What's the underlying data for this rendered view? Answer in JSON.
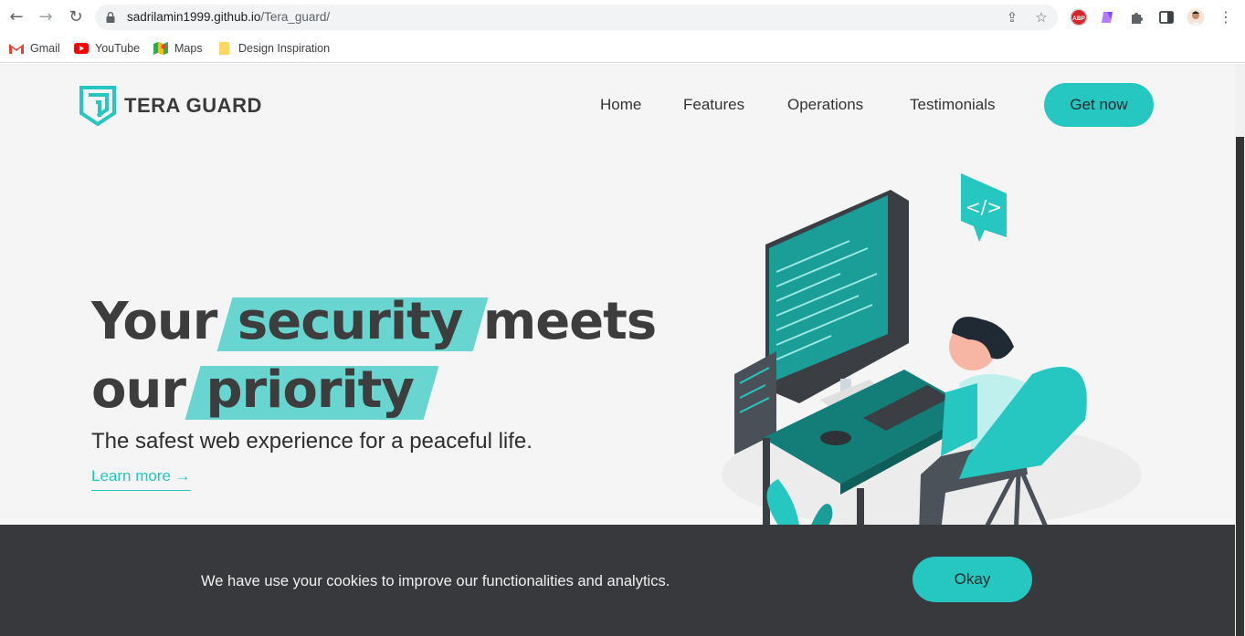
{
  "browser": {
    "url_host": "sadrilamin1999.github.io",
    "url_path": "/Tera_guard/",
    "bookmarks": [
      {
        "label": "Gmail",
        "icon": "gmail-icon"
      },
      {
        "label": "YouTube",
        "icon": "youtube-icon"
      },
      {
        "label": "Maps",
        "icon": "maps-icon"
      },
      {
        "label": "Design Inspiration",
        "icon": "folder-icon"
      }
    ],
    "extension_badge": "ABP"
  },
  "site": {
    "logo_text": "TERA GUARD",
    "nav": [
      "Home",
      "Features",
      "Operations",
      "Testimonials"
    ],
    "cta_label": "Get now",
    "accent_color": "#26c6c1"
  },
  "hero": {
    "line1_a": "Your",
    "line1_highlight": "security",
    "line1_b": "meets",
    "line2_a": "our",
    "line2_highlight": "priority",
    "subtitle": "The safest web experience for a peaceful life.",
    "learn_more": "Learn more →"
  },
  "cookie": {
    "text": "We have use your cookies to improve our functionalities and analytics.",
    "button": "Okay",
    "background": "#37393d"
  }
}
